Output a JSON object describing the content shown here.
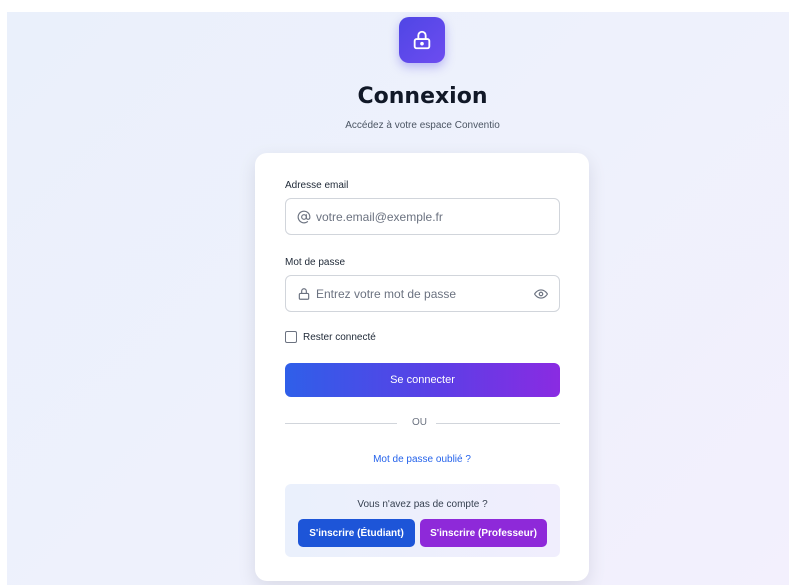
{
  "header": {
    "logo_icon": "lock-icon",
    "title": "Connexion",
    "subtitle": "Accédez à votre espace Conventio"
  },
  "form": {
    "email": {
      "label": "Adresse email",
      "placeholder": "votre.email@exemple.fr",
      "value": "",
      "icon": "at-icon"
    },
    "password": {
      "label": "Mot de passe",
      "placeholder": "Entrez votre mot de passe",
      "value": "",
      "icon": "lock-icon",
      "toggle_icon": "eye-icon"
    },
    "remember": {
      "label": "Rester connecté",
      "checked": false
    },
    "submit_label": "Se connecter",
    "divider_text": "OU",
    "forgot_label": "Mot de passe oublié ?"
  },
  "signup": {
    "question": "Vous n'avez pas de compte ?",
    "student_label": "S'inscrire (Étudiant)",
    "professor_label": "S'inscrire (Professeur)"
  },
  "colors": {
    "primary_blue": "#2563eb",
    "brand_indigo": "#4f46e5",
    "purple": "#8e29d9",
    "student_button": "#1d55d8"
  }
}
